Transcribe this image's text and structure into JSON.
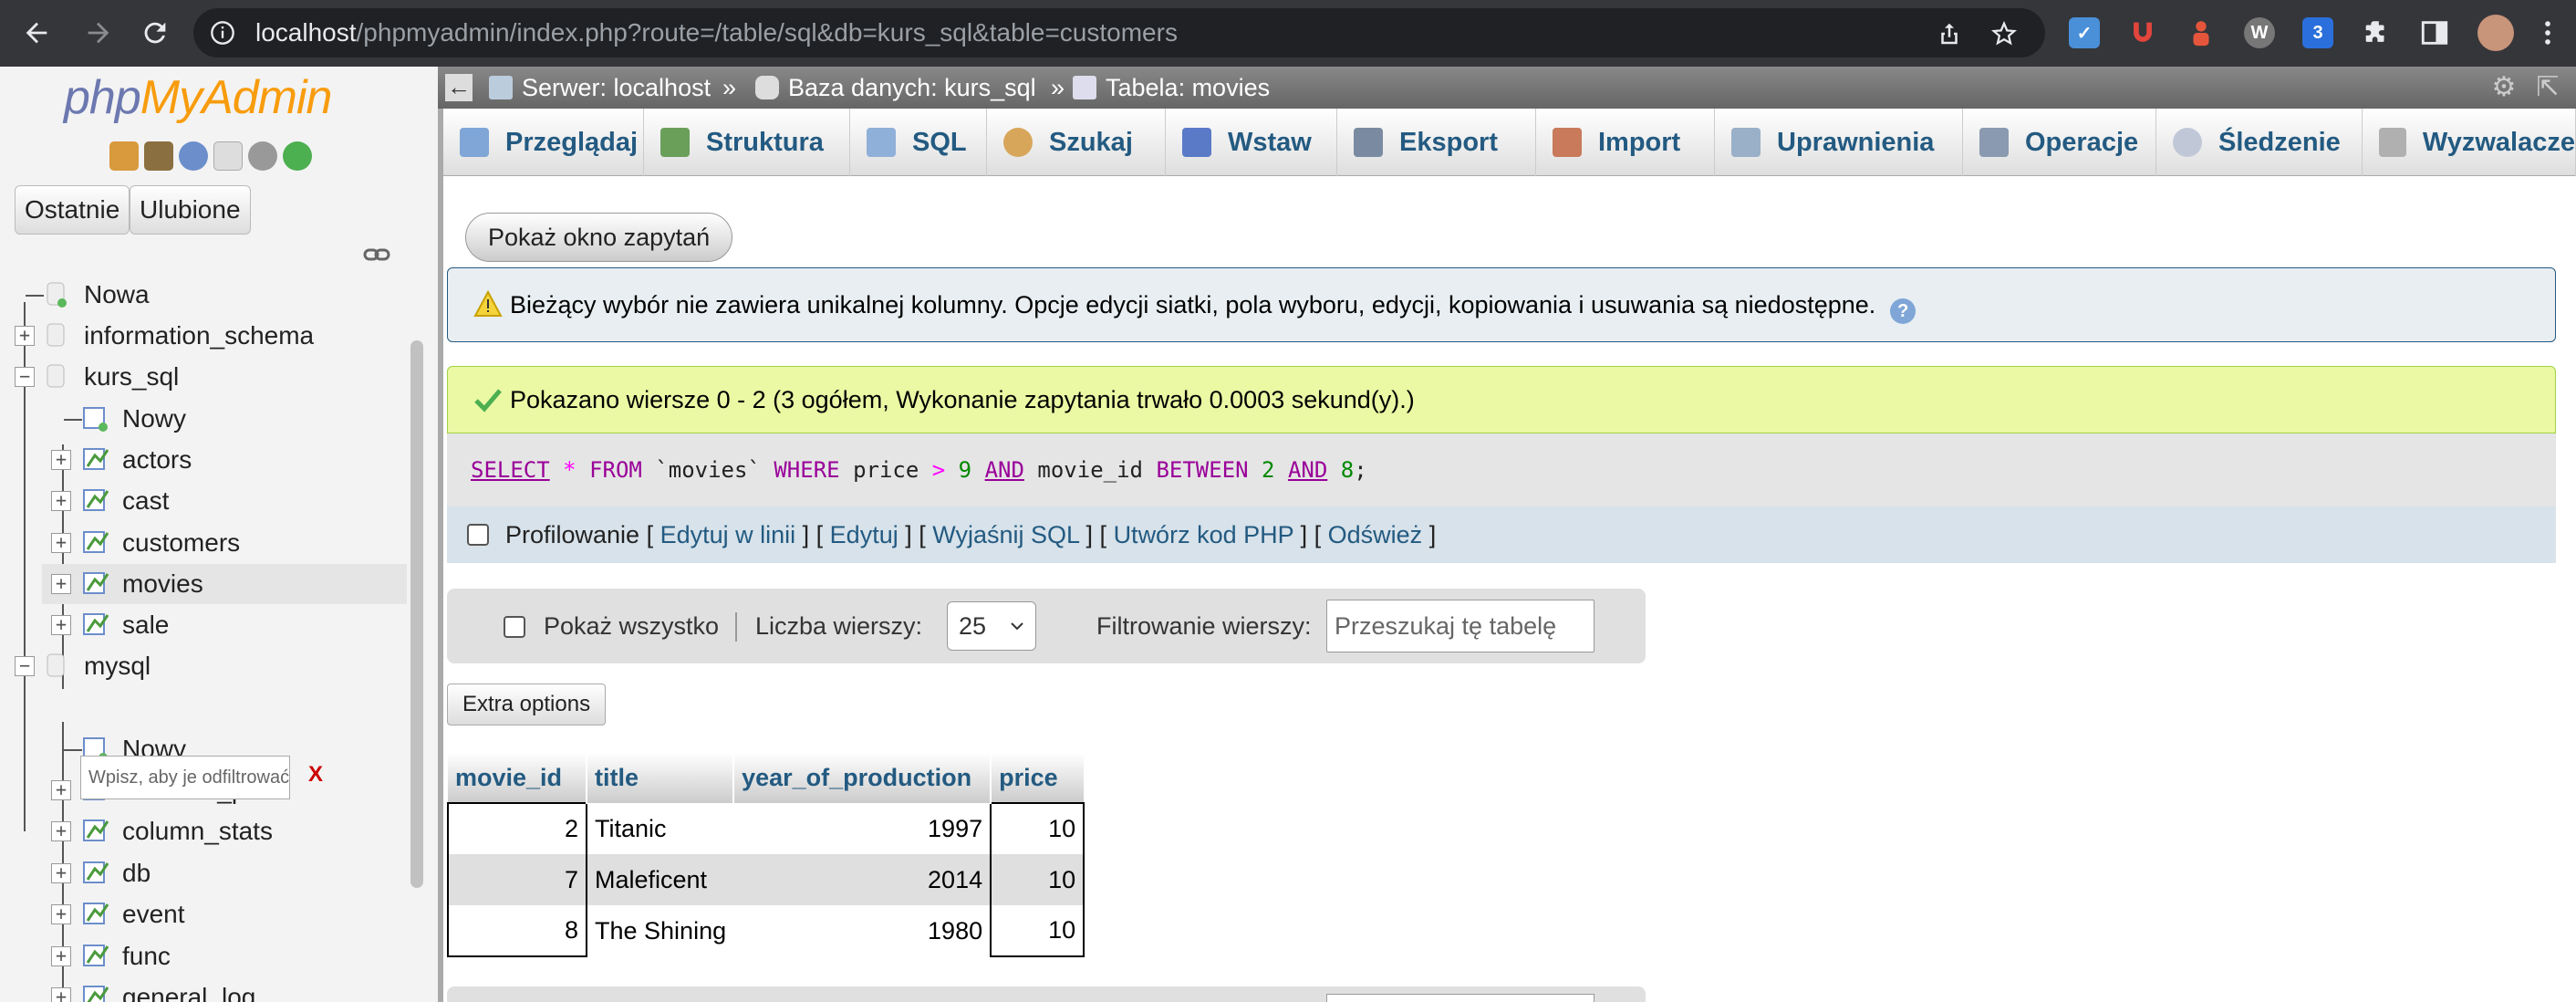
{
  "browser": {
    "url_host": "localhost",
    "url_path": "/phpmyadmin/index.php?route=/table/sql&db=kurs_sql&table=customers"
  },
  "sidebar": {
    "logo_php": "php",
    "logo_myadmin": "MyAdmin",
    "tab_recent": "Ostatnie",
    "tab_favorites": "Ulubione",
    "tree": [
      {
        "label": "Nowa"
      },
      {
        "label": "information_schema"
      },
      {
        "label": "kurs_sql"
      },
      {
        "label": "Nowy"
      },
      {
        "label": "actors"
      },
      {
        "label": "cast"
      },
      {
        "label": "customers"
      },
      {
        "label": "movies"
      },
      {
        "label": "sale"
      },
      {
        "label": "mysql"
      },
      {
        "label": "Nowy"
      },
      {
        "label": "columns_priv"
      },
      {
        "label": "column_stats"
      },
      {
        "label": "db"
      },
      {
        "label": "event"
      },
      {
        "label": "func"
      },
      {
        "label": "general_log"
      }
    ],
    "filter_placeholder": "Wpisz, aby je odfiltrować,",
    "filter_clear": "X"
  },
  "breadcrumb": {
    "server": "Serwer: localhost",
    "database": "Baza danych: kurs_sql",
    "table": "Tabela: movies",
    "sep": "»"
  },
  "menu": [
    {
      "label": "Przeglądaj",
      "icon": "browse-icon"
    },
    {
      "label": "Struktura",
      "icon": "structure-icon"
    },
    {
      "label": "SQL",
      "icon": "sql-icon"
    },
    {
      "label": "Szukaj",
      "icon": "search-icon"
    },
    {
      "label": "Wstaw",
      "icon": "insert-icon"
    },
    {
      "label": "Eksport",
      "icon": "export-icon"
    },
    {
      "label": "Import",
      "icon": "import-icon"
    },
    {
      "label": "Uprawnienia",
      "icon": "privileges-icon"
    },
    {
      "label": "Operacje",
      "icon": "operations-icon"
    },
    {
      "label": "Śledzenie",
      "icon": "tracking-icon"
    },
    {
      "label": "Wyzwalacze",
      "icon": "triggers-icon"
    }
  ],
  "content": {
    "show_query_button": "Pokaż okno zapytań",
    "notice": "Bieżący wybór nie zawiera unikalnej kolumny. Opcje edycji siatki, pola wyboru, edycji, kopiowania i usuwania są niedostępne.",
    "success": "Pokazano wiersze 0 - 2 (3 ogółem, Wykonanie zapytania trwało 0.0003 sekund(y).)",
    "sql": {
      "select": "SELECT",
      "star": "*",
      "from": "FROM",
      "table": "`movies`",
      "where": "WHERE",
      "col1": "price",
      "gt": ">",
      "n1": "9",
      "and1": "AND",
      "col2": "movie_id",
      "between": "BETWEEN",
      "n2": "2",
      "and2": "AND",
      "n3": "8",
      "semi": ";"
    },
    "links": {
      "profiling": "Profilowanie",
      "edit_inline": "Edytuj w linii",
      "edit": "Edytuj",
      "explain": "Wyjaśnij SQL",
      "create_php": "Utwórz kod PHP",
      "refresh": "Odśwież"
    },
    "nav": {
      "show_all": "Pokaż wszystko",
      "row_count_label": "Liczba wierszy:",
      "row_count_value": "25",
      "filter_label": "Filtrowanie wierszy:",
      "filter_placeholder": "Przeszukaj tę tabelę"
    },
    "extra_options": "Extra options",
    "table": {
      "columns": [
        "movie_id",
        "title",
        "year_of_production",
        "price"
      ],
      "rows": [
        [
          "2",
          "Titanic",
          "1997",
          "10"
        ],
        [
          "7",
          "Maleficent",
          "2014",
          "10"
        ],
        [
          "8",
          "The Shining",
          "1980",
          "10"
        ]
      ]
    }
  }
}
